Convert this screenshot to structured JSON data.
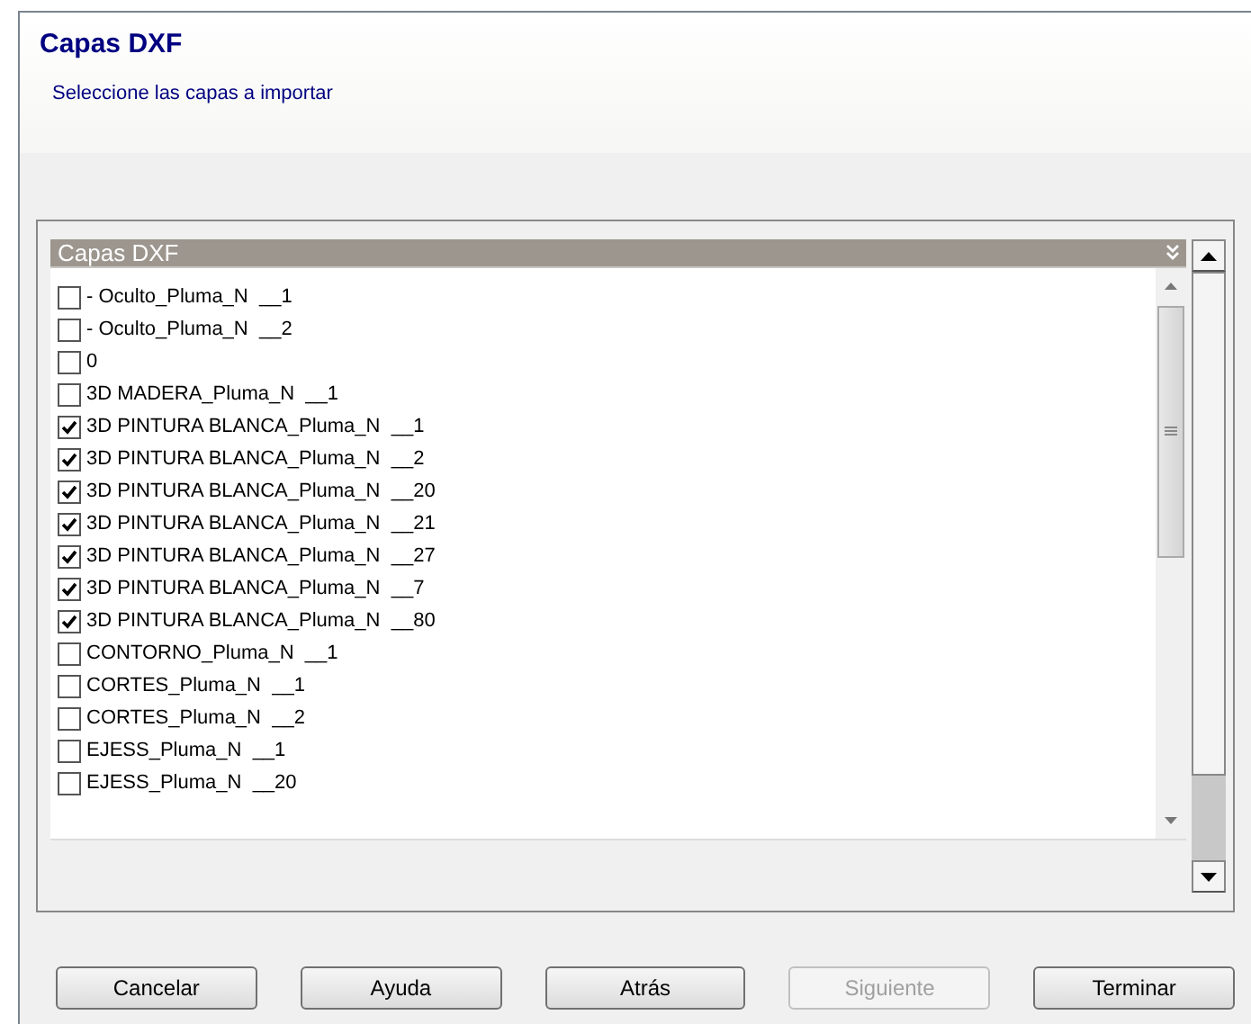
{
  "header": {
    "title": "Capas DXF",
    "subtitle": "Seleccione las capas a importar"
  },
  "layer_list": {
    "heading": "Capas DXF",
    "items": [
      {
        "label": "- Oculto_Pluma_N  __1",
        "checked": false
      },
      {
        "label": "- Oculto_Pluma_N  __2",
        "checked": false
      },
      {
        "label": "0",
        "checked": false
      },
      {
        "label": "3D MADERA_Pluma_N  __1",
        "checked": false
      },
      {
        "label": "3D PINTURA BLANCA_Pluma_N  __1",
        "checked": true
      },
      {
        "label": "3D PINTURA BLANCA_Pluma_N  __2",
        "checked": true
      },
      {
        "label": "3D PINTURA BLANCA_Pluma_N  __20",
        "checked": true
      },
      {
        "label": "3D PINTURA BLANCA_Pluma_N  __21",
        "checked": true
      },
      {
        "label": "3D PINTURA BLANCA_Pluma_N  __27",
        "checked": true
      },
      {
        "label": "3D PINTURA BLANCA_Pluma_N  __7",
        "checked": true
      },
      {
        "label": "3D PINTURA BLANCA_Pluma_N  __80",
        "checked": true
      },
      {
        "label": "CONTORNO_Pluma_N  __1",
        "checked": false
      },
      {
        "label": "CORTES_Pluma_N  __1",
        "checked": false
      },
      {
        "label": "CORTES_Pluma_N  __2",
        "checked": false
      },
      {
        "label": "EJESS_Pluma_N  __1",
        "checked": false
      },
      {
        "label": "EJESS_Pluma_N  __20",
        "checked": false
      }
    ]
  },
  "buttons": [
    {
      "label": "Cancelar",
      "disabled": false
    },
    {
      "label": "Ayuda",
      "disabled": false
    },
    {
      "label": "Atrás",
      "disabled": false
    },
    {
      "label": "Siguiente",
      "disabled": true
    },
    {
      "label": "Terminar",
      "disabled": false
    }
  ]
}
